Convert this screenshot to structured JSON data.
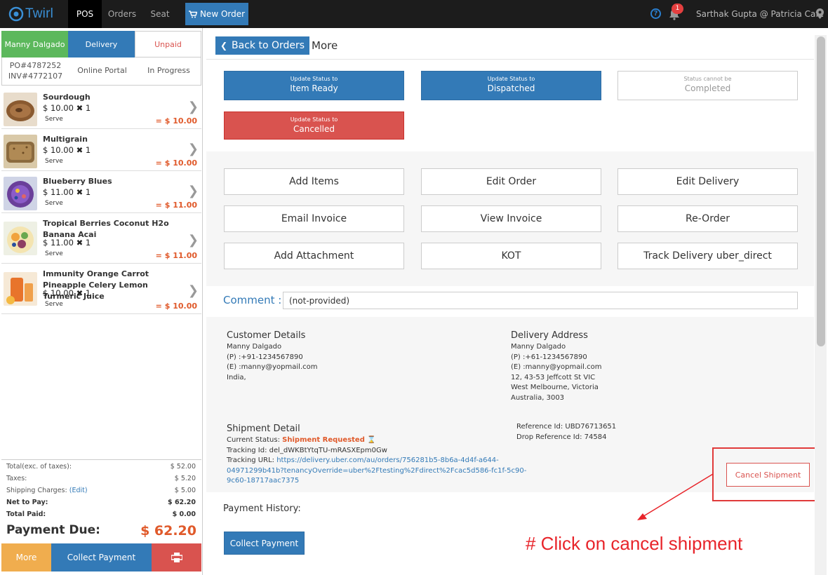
{
  "topbar": {
    "logo_text": "Twirl",
    "nav": [
      "POS",
      "Orders",
      "Seat"
    ],
    "new_order": "New Order",
    "help_icon": "question-circle-icon",
    "notification_count": "1",
    "user": "Sarthak Gupta @ Patricia Cafe"
  },
  "order": {
    "customer": "Manny Dalgado",
    "type": "Delivery",
    "payment_status": "Unpaid",
    "po": "PO#4787252",
    "inv": "INV#4772107",
    "source": "Online Portal",
    "progress": "In Progress"
  },
  "items": [
    {
      "name": "Sourdough",
      "price": "$ 10.00",
      "qty": "1",
      "note": "Serve",
      "total": "= $ 10.00"
    },
    {
      "name": "Multigrain",
      "price": "$ 10.00",
      "qty": "1",
      "note": "Serve",
      "total": "= $ 10.00"
    },
    {
      "name": "Blueberry Blues",
      "price": "$ 11.00",
      "qty": "1",
      "note": "Serve",
      "total": "= $ 11.00"
    },
    {
      "name": "Tropical Berries Coconut H2o Banana Acai",
      "price": "$ 11.00",
      "qty": "1",
      "note": "Serve",
      "total": "= $ 11.00"
    },
    {
      "name": "Immunity Orange Carrot Pineapple Celery Lemon Turmeric Juice",
      "price": "$ 10.00",
      "qty": "1",
      "note": "Serve",
      "total": "= $ 10.00"
    }
  ],
  "totals": {
    "subtotal_label": "Total(exc. of taxes):",
    "subtotal": "$ 52.00",
    "taxes_label": "Taxes:",
    "taxes": "$ 5.20",
    "shipping_label": "Shipping Charges:",
    "shipping_edit": "(Edit)",
    "shipping": "$ 5.00",
    "net_label": "Net to Pay:",
    "net": "$ 62.20",
    "paid_label": "Total Paid:",
    "paid": "$ 0.00",
    "due_label": "Payment Due:",
    "due": "$ 62.20"
  },
  "left_buttons": {
    "more": "More",
    "collect": "Collect Payment",
    "print_icon": "printer-icon"
  },
  "header": {
    "back": "Back to Orders",
    "title": "More"
  },
  "status_buttons": [
    {
      "small": "Update Status to",
      "main": "Item Ready"
    },
    {
      "small": "Update Status to",
      "main": "Dispatched"
    },
    {
      "small": "Status cannot be",
      "main": "Completed"
    },
    {
      "small": "Update Status to",
      "main": "Cancelled"
    }
  ],
  "actions": [
    "Add Items",
    "Edit Order",
    "Edit Delivery",
    "Email Invoice",
    "View Invoice",
    "Re-Order",
    "Add Attachment",
    "KOT",
    "Track Delivery uber_direct"
  ],
  "comment": {
    "label": "Comment :",
    "value": "(not-provided)"
  },
  "customer_details": {
    "title": "Customer Details",
    "lines": [
      "Manny Dalgado",
      "(P) :+91-1234567890",
      "(E) :manny@yopmail.com",
      "India,"
    ]
  },
  "delivery_address": {
    "title": "Delivery Address",
    "lines": [
      "Manny Dalgado",
      "(P) :+61-1234567890",
      "(E) :manny@yopmail.com",
      "12, 43-53 Jeffcott St VIC",
      "West Melbourne, Victoria",
      "Australia, 3003"
    ]
  },
  "shipment": {
    "title": "Shipment Detail",
    "status_label": "Current Status:",
    "status": "Shipment Requested",
    "tracking_id": "Tracking Id: del_dWKBtYtqTU-mRASXEpm0Gw",
    "tracking_url_label": "Tracking URL:",
    "tracking_url_1": "https://delivery.uber.com/au/orders/756281b5-8b6a-4d4f-a644-",
    "tracking_url_2": "04971299b41b?tenancyOverride=uber%2Ftesting%2Fdirect%2Fcac5d586-fc1f-5c90-",
    "tracking_url_3": "9c60-18717aac7375",
    "reference": "Reference Id: UBD76713651",
    "drop_reference": "Drop Reference Id: 74584",
    "cancel": "Cancel Shipment"
  },
  "payment_history": {
    "title": "Payment History:",
    "collect": "Collect Payment"
  },
  "annotation": "# Click on cancel shipment"
}
